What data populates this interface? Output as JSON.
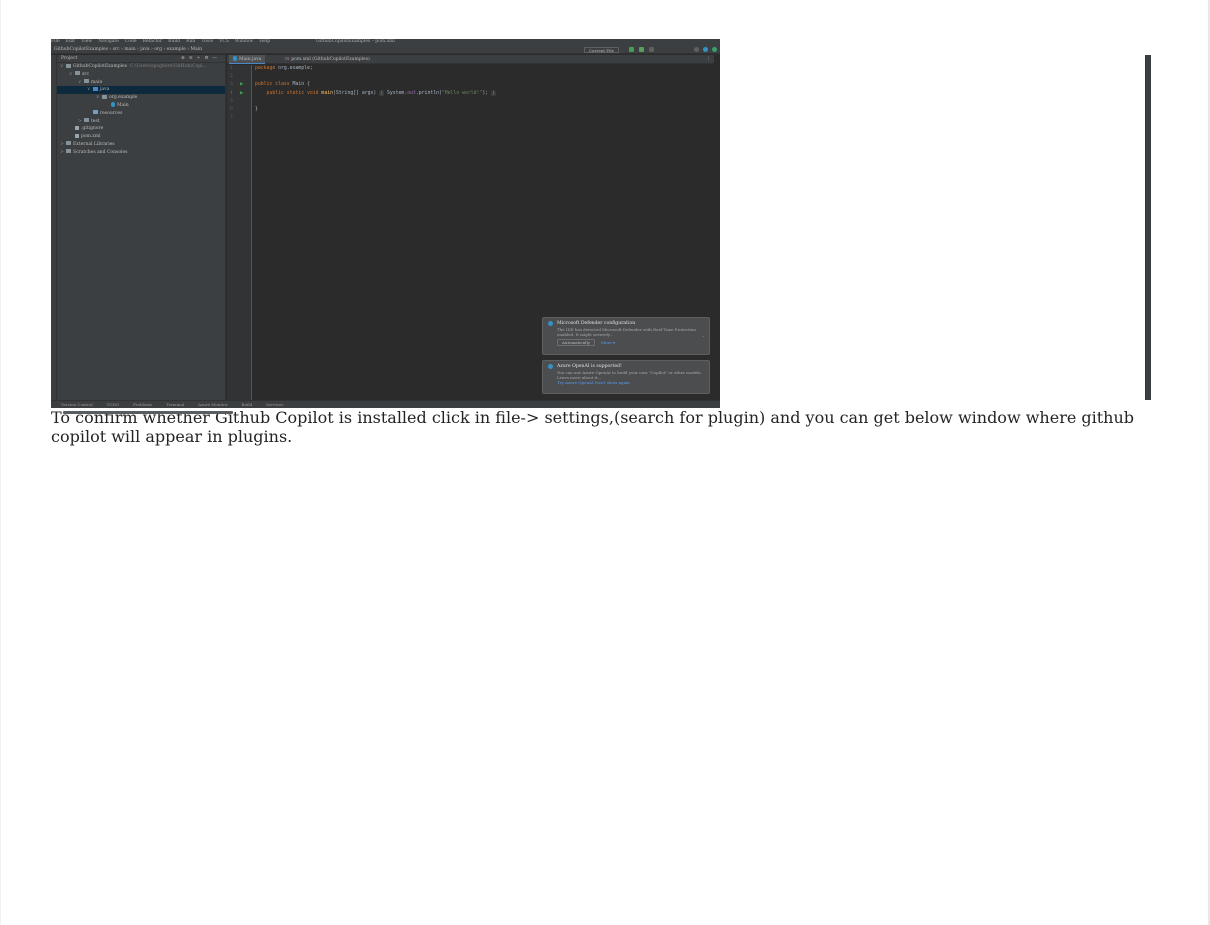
{
  "article": {
    "text": "To confirm whether Github Copilot is installed click in file-> settings,(search for plugin) and you can get below window where github copilot will appear in plugins."
  },
  "ide": {
    "menu": [
      "File",
      "Edit",
      "View",
      "Navigate",
      "Code",
      "Refactor",
      "Build",
      "Run",
      "Tools",
      "VCS",
      "Window",
      "Help"
    ],
    "window_title": "GithubCopilotExamples – pom.xml",
    "breadcrumbs": "GithubCopilotExamples › src › main › java › org › example › Main",
    "run_config": "Current File",
    "project_panel": {
      "title": "Project",
      "rows": [
        {
          "arrow": "∨",
          "label": "GithubCopilotExamples",
          "suffix": "C:\\Users\\spoghore\\GitHub\\Copi...",
          "indent": 0,
          "icon": "folder"
        },
        {
          "arrow": "∨",
          "label": "src",
          "suffix": "",
          "indent": 1,
          "icon": "folder"
        },
        {
          "arrow": "∨",
          "label": "main",
          "suffix": "",
          "indent": 2,
          "icon": "folder"
        },
        {
          "arrow": "∨",
          "label": "java",
          "suffix": "",
          "indent": 3,
          "icon": "folder-blue",
          "selected": true
        },
        {
          "arrow": "∨",
          "label": "org.example",
          "suffix": "",
          "indent": 4,
          "icon": "folder"
        },
        {
          "arrow": "",
          "label": "Main",
          "suffix": "",
          "indent": 5,
          "icon": "class"
        },
        {
          "arrow": "",
          "label": "resources",
          "suffix": "",
          "indent": 3,
          "icon": "folder-src"
        },
        {
          "arrow": ">",
          "label": "test",
          "suffix": "",
          "indent": 2,
          "icon": "folder"
        },
        {
          "arrow": "",
          "label": ".gitignore",
          "suffix": "",
          "indent": 1,
          "icon": "file"
        },
        {
          "arrow": "",
          "label": "pom.xml",
          "suffix": "",
          "indent": 1,
          "icon": "file"
        },
        {
          "arrow": ">",
          "label": "External Libraries",
          "suffix": "",
          "indent": 0,
          "icon": "folder"
        },
        {
          "arrow": ">",
          "label": "Scratches and Consoles",
          "suffix": "",
          "indent": 0,
          "icon": "folder"
        }
      ]
    },
    "tabs": [
      "Main.java",
      "pom.xml (GithubCopilotExamples)"
    ],
    "gutter": [
      "1",
      "2",
      "3",
      "4",
      "5",
      "6",
      "7"
    ],
    "code": {
      "line1_kw": "package",
      "line1_rest": " org.example;",
      "line3_kw": "public class",
      "line3_rest": " Main {",
      "line4_kw": "    public static void",
      "line4_fn": " main",
      "line4_args": "(String[] args)",
      "line4_hint": "{",
      "line4_body": " System.",
      "line4_field": "out",
      "line4_call": ".println(",
      "line4_str": "\"Hello world!\"",
      "line4_end": ");",
      "line4_close": "}",
      "line6": "}"
    },
    "notifications": [
      {
        "title": "Microsoft Defender configuration",
        "body": "The IDE has detected Microsoft Defender with Real-Time Protection enabled. It might severely...",
        "button": "Automatically",
        "link": "More ▾"
      },
      {
        "title": "Azure OpenAI is supported!",
        "body": "You can use Azure OpenAI to build your own \"Copilot\" or other models. Learn more about it...",
        "button": "",
        "link": "Try Azure OpenAI    Don't show again"
      }
    ],
    "statusbar": [
      "Version Control",
      "TODO",
      "Problems",
      "Terminal",
      "Azure Monitor",
      "Build",
      "Services"
    ]
  }
}
